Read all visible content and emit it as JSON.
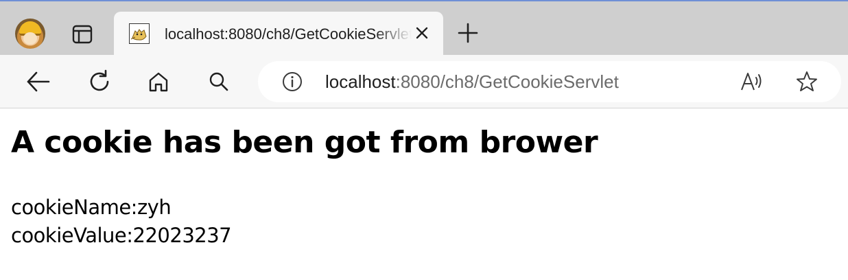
{
  "browser": {
    "tab": {
      "title": "localhost:8080/ch8/GetCookieServlet",
      "favicon": "tomcat-icon"
    },
    "address_bar": {
      "host": "localhost",
      "path": ":8080/ch8/GetCookieServlet"
    },
    "icons": {
      "profile": "profile-avatar",
      "tab_actions": "tab-actions-icon",
      "close": "close-icon",
      "new_tab": "plus-icon",
      "back": "back-arrow-icon",
      "refresh": "refresh-icon",
      "home": "home-icon",
      "search": "search-icon",
      "info": "info-icon",
      "read_aloud": "read-aloud-icon",
      "favorite": "star-icon"
    },
    "colors": {
      "tabstrip": "#cfcfcf",
      "toolbar": "#f7f7f7",
      "url_host": "#1f1f1f",
      "url_path": "#6b6b6b"
    }
  },
  "page": {
    "heading": "A cookie has been got from brower",
    "lines": [
      "cookieName:zyh",
      "cookieValue:22023237"
    ]
  }
}
